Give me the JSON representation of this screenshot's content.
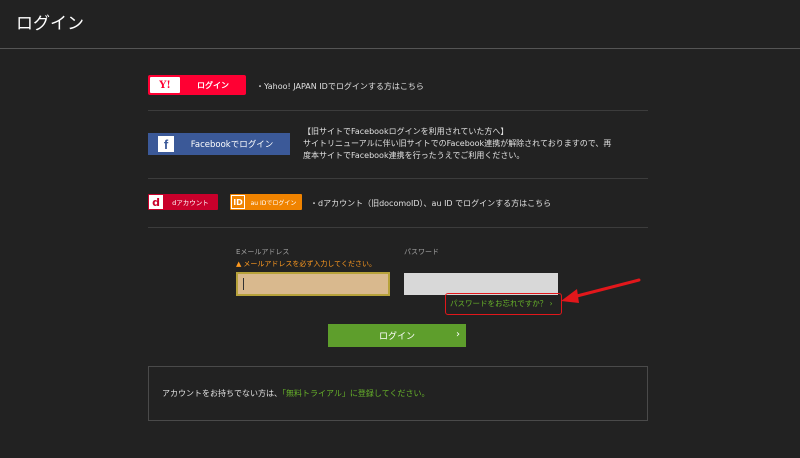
{
  "header": {
    "title": "ログイン"
  },
  "yahoo": {
    "logo": "Y!",
    "button_label": "ログイン",
    "description": "・Yahoo! JAPAN IDでログインする方はこちら"
  },
  "facebook": {
    "logo": "f",
    "button_label": "Facebookでログイン",
    "notice_lines": [
      "【旧サイトでFacebookログインを利用されていた方へ】",
      "サイトリニューアルに伴い旧サイトでのFacebook連携が解除されておりますので、再",
      "度本サイトでFacebook連携を行ったうえでご利用ください。"
    ]
  },
  "docomo": {
    "logo": "d",
    "button_label": "dアカウント",
    "au_logo": "ID",
    "au_button_label": "au IDでログイン",
    "description": "・dアカウント（旧docomoID）、au ID でログインする方はこちら"
  },
  "form": {
    "email_label": "Eメールアドレス",
    "email_warning": "メールアドレスを必ず入力してください。",
    "email_value": "",
    "password_label": "パスワード",
    "password_value": "",
    "forgot_link": "パスワードをお忘れですか？ ›",
    "login_button": "ログイン",
    "login_chevron": "›"
  },
  "signup": {
    "prefix": "アカウントをお持ちでない方は、",
    "link": "「無料トライアル」に登録してください。"
  },
  "colors": {
    "background": "#222222",
    "yahoo": "#ff0033",
    "facebook": "#3b5998",
    "docomo": "#c9002b",
    "au": "#f08300",
    "accent_green": "#5e9e2c",
    "warning": "#ff9a1f",
    "highlight_red": "#e2171b"
  }
}
